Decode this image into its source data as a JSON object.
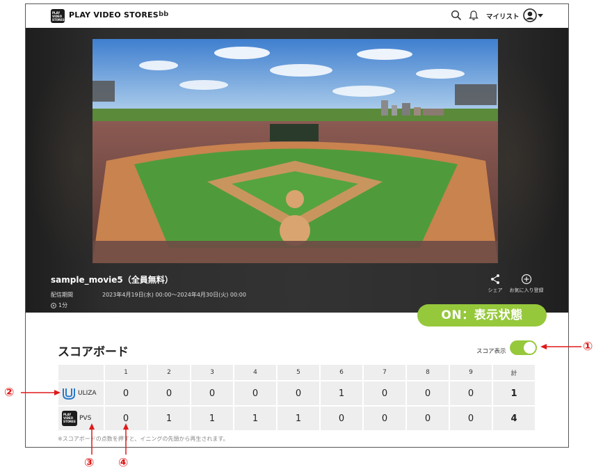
{
  "header": {
    "logo_lines": [
      "PLAY",
      "VIDEO",
      "STORES"
    ],
    "brand": "PLAY VIDEO STORES",
    "user_code": "bb",
    "mylist_label": "マイリスト",
    "icons": [
      "search-icon",
      "bell-icon",
      "user-avatar-icon",
      "chevron-down-icon"
    ]
  },
  "movie": {
    "title": "sample_movie5（全員無料）",
    "period_label": "配信期間",
    "period_value": "2023年4月19日(水) 00:00〜2024年4月30日(火) 00:00",
    "duration": "1分",
    "share_label": "シェア",
    "favorite_label": "お気に入り登録"
  },
  "callout": {
    "on_badge": "ON：表示状態",
    "markers": [
      "①",
      "②",
      "③",
      "④"
    ],
    "accent_color": "#96c83c",
    "marker_color": "#e01818"
  },
  "scoreboard": {
    "title": "スコアボード",
    "toggle_label": "スコア表示",
    "toggle_on": true,
    "headers": [
      "",
      "1",
      "2",
      "3",
      "4",
      "5",
      "6",
      "7",
      "8",
      "9",
      "計"
    ],
    "teams": [
      {
        "name": "ULIZA",
        "logo": "uliza-logo-icon",
        "scores": [
          "0",
          "0",
          "0",
          "0",
          "0",
          "1",
          "0",
          "0",
          "0"
        ],
        "total": "1"
      },
      {
        "name": "PVS",
        "logo": "pvs-logo-icon",
        "logo_lines": [
          "PLAY",
          "VIDEO",
          "STORES"
        ],
        "scores": [
          "0",
          "1",
          "1",
          "1",
          "1",
          "0",
          "0",
          "0",
          "0"
        ],
        "total": "4"
      }
    ],
    "note": "※スコアボードの点数を押すと、イニングの先頭から再生されます。"
  }
}
